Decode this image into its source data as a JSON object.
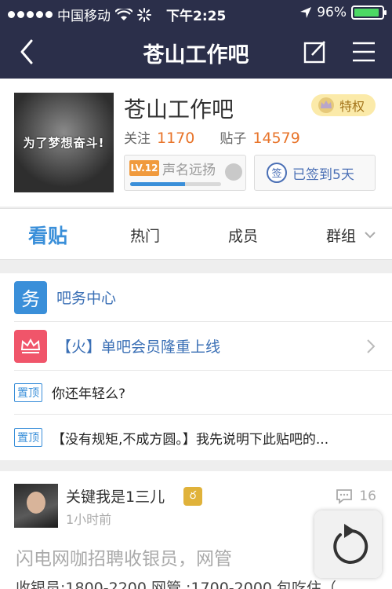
{
  "status": {
    "carrier": "中国移动",
    "time": "下午2:25",
    "battery": "96%"
  },
  "nav": {
    "title": "苍山工作吧"
  },
  "header": {
    "cover_text": "为了梦想奋斗!",
    "forum_name": "苍山工作吧",
    "privilege": "特权",
    "follow_label": "关注",
    "follow_count": "1170",
    "posts_label": "贴子",
    "posts_count": "14579",
    "level_badge": "LV.12",
    "level_name": "声名远扬",
    "level_progress": 0.6,
    "signin_icon": "签",
    "signin_text": "已签到5天"
  },
  "tabs": [
    "看贴",
    "热门",
    "成员",
    "群组"
  ],
  "list": {
    "service_icon": "务",
    "service": "吧务中心",
    "member_notice": "【火】单吧会员隆重上线",
    "pinned_badge": "置顶",
    "pinned": [
      "你还年轻么?",
      "【没有规矩,不成方圆。】我先说明下此贴吧的..."
    ]
  },
  "post": {
    "username": "关键我是1三儿",
    "badge": "ర",
    "time": "1小时前",
    "comments": "16",
    "title": "闪电网咖招聘收银员，网管",
    "body": "收银员:1800-2200 网管 :1700-2000 包吃住（"
  },
  "colors": {
    "nav_bg": "#2b2f4a",
    "accent": "#3a8fd9",
    "count": "#e8742a"
  }
}
